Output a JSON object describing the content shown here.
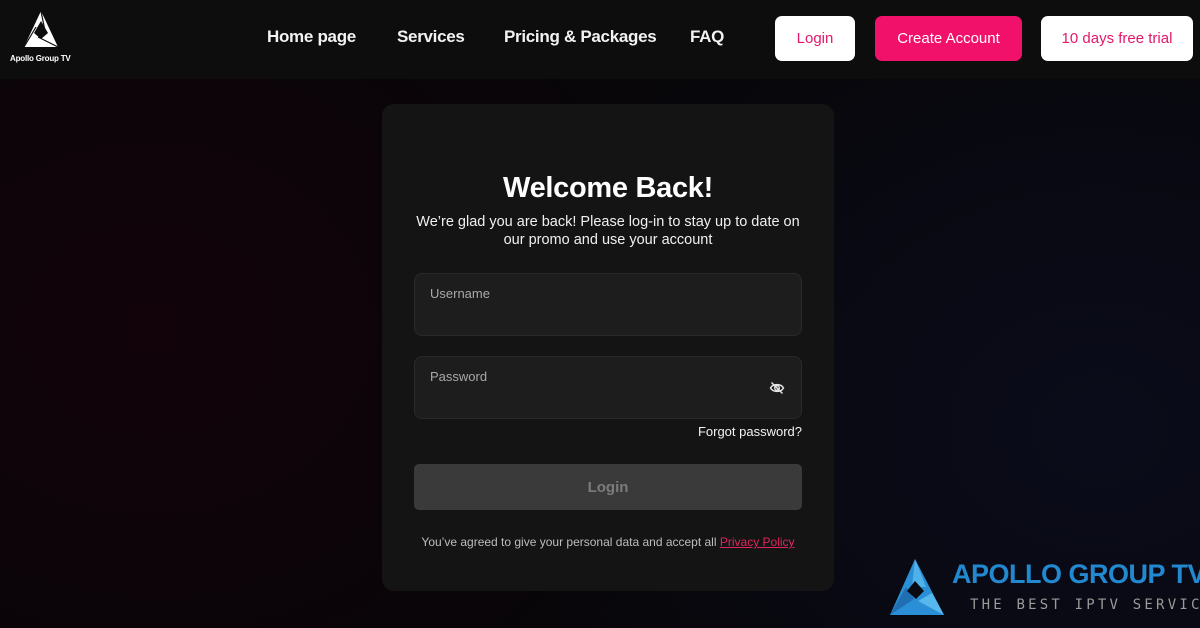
{
  "brand": {
    "name": "Apollo Group TV",
    "logo_icon": "aperture-triangle-icon"
  },
  "nav": {
    "items": [
      {
        "label": "Home page"
      },
      {
        "label": "Services"
      },
      {
        "label": "Pricing & Packages"
      },
      {
        "label": "FAQ"
      }
    ],
    "login_label": "Login",
    "create_account_label": "Create Account",
    "trial_label": "10 days free trial"
  },
  "login_card": {
    "title": "Welcome Back!",
    "subtitle": "We’re glad you are back! Please log-in to stay up to date on our promo and use your account",
    "username": {
      "label": "Username",
      "value": ""
    },
    "password": {
      "label": "Password",
      "value": "",
      "toggle_icon": "eye-off-icon"
    },
    "forgot_label": "Forgot password?",
    "submit_label": "Login",
    "agreement_text": "You’ve agreed to give your personal data and accept all",
    "privacy_link": "Privacy Policy"
  },
  "watermark": {
    "title": "APOLLO GROUP TV",
    "tagline": "THE BEST IPTV SERVICE"
  },
  "colors": {
    "accent": "#f1116a",
    "link": "#e0245e",
    "watermark_blue": "#2288cf"
  }
}
